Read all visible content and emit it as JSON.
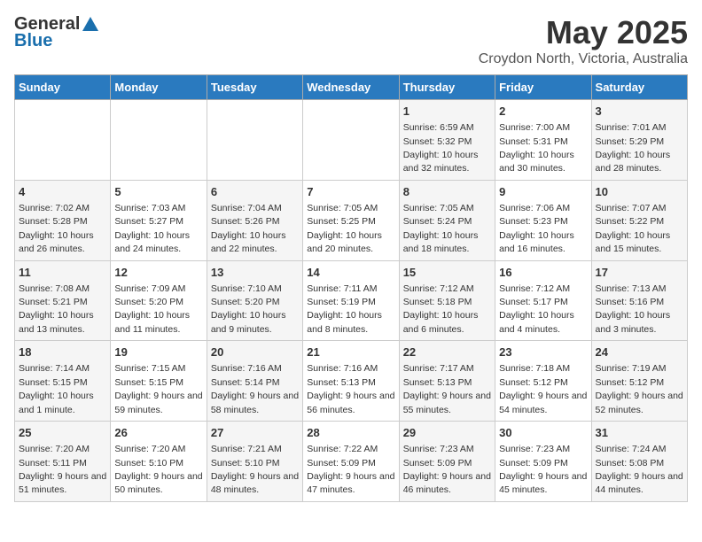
{
  "header": {
    "logo_general": "General",
    "logo_blue": "Blue",
    "month_title": "May 2025",
    "location": "Croydon North, Victoria, Australia"
  },
  "days_of_week": [
    "Sunday",
    "Monday",
    "Tuesday",
    "Wednesday",
    "Thursday",
    "Friday",
    "Saturday"
  ],
  "weeks": [
    [
      null,
      null,
      null,
      null,
      {
        "day": 1,
        "sunrise": "6:59 AM",
        "sunset": "5:32 PM",
        "daylight": "10 hours and 32 minutes."
      },
      {
        "day": 2,
        "sunrise": "7:00 AM",
        "sunset": "5:31 PM",
        "daylight": "10 hours and 30 minutes."
      },
      {
        "day": 3,
        "sunrise": "7:01 AM",
        "sunset": "5:29 PM",
        "daylight": "10 hours and 28 minutes."
      }
    ],
    [
      {
        "day": 4,
        "sunrise": "7:02 AM",
        "sunset": "5:28 PM",
        "daylight": "10 hours and 26 minutes."
      },
      {
        "day": 5,
        "sunrise": "7:03 AM",
        "sunset": "5:27 PM",
        "daylight": "10 hours and 24 minutes."
      },
      {
        "day": 6,
        "sunrise": "7:04 AM",
        "sunset": "5:26 PM",
        "daylight": "10 hours and 22 minutes."
      },
      {
        "day": 7,
        "sunrise": "7:05 AM",
        "sunset": "5:25 PM",
        "daylight": "10 hours and 20 minutes."
      },
      {
        "day": 8,
        "sunrise": "7:05 AM",
        "sunset": "5:24 PM",
        "daylight": "10 hours and 18 minutes."
      },
      {
        "day": 9,
        "sunrise": "7:06 AM",
        "sunset": "5:23 PM",
        "daylight": "10 hours and 16 minutes."
      },
      {
        "day": 10,
        "sunrise": "7:07 AM",
        "sunset": "5:22 PM",
        "daylight": "10 hours and 15 minutes."
      }
    ],
    [
      {
        "day": 11,
        "sunrise": "7:08 AM",
        "sunset": "5:21 PM",
        "daylight": "10 hours and 13 minutes."
      },
      {
        "day": 12,
        "sunrise": "7:09 AM",
        "sunset": "5:20 PM",
        "daylight": "10 hours and 11 minutes."
      },
      {
        "day": 13,
        "sunrise": "7:10 AM",
        "sunset": "5:20 PM",
        "daylight": "10 hours and 9 minutes."
      },
      {
        "day": 14,
        "sunrise": "7:11 AM",
        "sunset": "5:19 PM",
        "daylight": "10 hours and 8 minutes."
      },
      {
        "day": 15,
        "sunrise": "7:12 AM",
        "sunset": "5:18 PM",
        "daylight": "10 hours and 6 minutes."
      },
      {
        "day": 16,
        "sunrise": "7:12 AM",
        "sunset": "5:17 PM",
        "daylight": "10 hours and 4 minutes."
      },
      {
        "day": 17,
        "sunrise": "7:13 AM",
        "sunset": "5:16 PM",
        "daylight": "10 hours and 3 minutes."
      }
    ],
    [
      {
        "day": 18,
        "sunrise": "7:14 AM",
        "sunset": "5:15 PM",
        "daylight": "10 hours and 1 minute."
      },
      {
        "day": 19,
        "sunrise": "7:15 AM",
        "sunset": "5:15 PM",
        "daylight": "9 hours and 59 minutes."
      },
      {
        "day": 20,
        "sunrise": "7:16 AM",
        "sunset": "5:14 PM",
        "daylight": "9 hours and 58 minutes."
      },
      {
        "day": 21,
        "sunrise": "7:16 AM",
        "sunset": "5:13 PM",
        "daylight": "9 hours and 56 minutes."
      },
      {
        "day": 22,
        "sunrise": "7:17 AM",
        "sunset": "5:13 PM",
        "daylight": "9 hours and 55 minutes."
      },
      {
        "day": 23,
        "sunrise": "7:18 AM",
        "sunset": "5:12 PM",
        "daylight": "9 hours and 54 minutes."
      },
      {
        "day": 24,
        "sunrise": "7:19 AM",
        "sunset": "5:12 PM",
        "daylight": "9 hours and 52 minutes."
      }
    ],
    [
      {
        "day": 25,
        "sunrise": "7:20 AM",
        "sunset": "5:11 PM",
        "daylight": "9 hours and 51 minutes."
      },
      {
        "day": 26,
        "sunrise": "7:20 AM",
        "sunset": "5:10 PM",
        "daylight": "9 hours and 50 minutes."
      },
      {
        "day": 27,
        "sunrise": "7:21 AM",
        "sunset": "5:10 PM",
        "daylight": "9 hours and 48 minutes."
      },
      {
        "day": 28,
        "sunrise": "7:22 AM",
        "sunset": "5:09 PM",
        "daylight": "9 hours and 47 minutes."
      },
      {
        "day": 29,
        "sunrise": "7:23 AM",
        "sunset": "5:09 PM",
        "daylight": "9 hours and 46 minutes."
      },
      {
        "day": 30,
        "sunrise": "7:23 AM",
        "sunset": "5:09 PM",
        "daylight": "9 hours and 45 minutes."
      },
      {
        "day": 31,
        "sunrise": "7:24 AM",
        "sunset": "5:08 PM",
        "daylight": "9 hours and 44 minutes."
      }
    ]
  ]
}
